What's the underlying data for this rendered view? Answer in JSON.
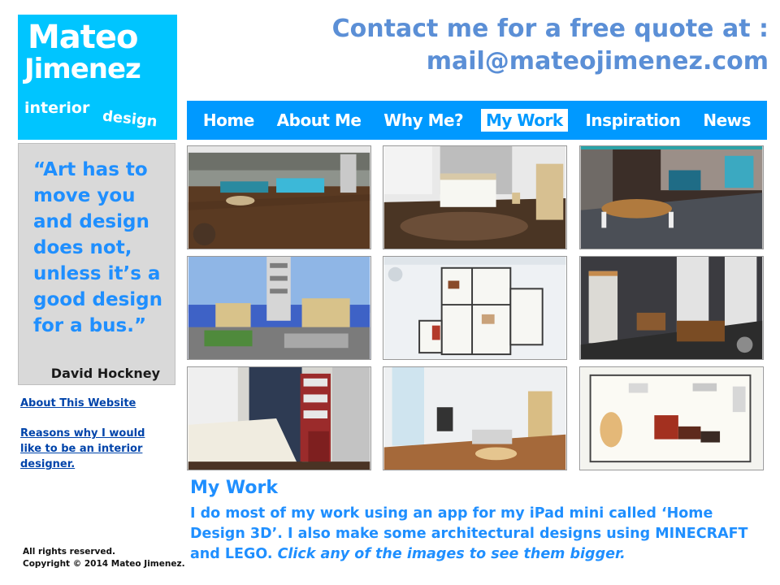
{
  "logo": {
    "line1": "Mateo",
    "line2": "Jimenez",
    "tag1": "interior",
    "tag2": "design"
  },
  "contact": {
    "line1": "Contact me for a free quote at :",
    "line2": "mail@mateojimenez.com"
  },
  "nav": {
    "items": [
      {
        "label": "Home"
      },
      {
        "label": "About Me"
      },
      {
        "label": "Why Me?"
      },
      {
        "label": "My Work",
        "active": true
      },
      {
        "label": "Inspiration"
      },
      {
        "label": "News"
      }
    ]
  },
  "quote": {
    "text": "“Art has to move you and design does not, unless it’s a good design for a bus.”",
    "author": "David Hockney"
  },
  "sidebar": {
    "links": [
      {
        "label": "About This Website"
      },
      {
        "label": "Reasons why I would like to be an interior designer."
      }
    ]
  },
  "gallery": {
    "images": [
      {
        "name": "living-room-3d"
      },
      {
        "name": "bedroom-3d"
      },
      {
        "name": "kitchen-dining-3d"
      },
      {
        "name": "minecraft-build"
      },
      {
        "name": "floor-plan-rooms"
      },
      {
        "name": "dark-bedroom-3d"
      },
      {
        "name": "bedroom-bookshelf-3d"
      },
      {
        "name": "tv-lounge-3d"
      },
      {
        "name": "floor-plan-room1-room2"
      }
    ]
  },
  "work": {
    "title": "My Work",
    "text": "I do most of my work using an app for my iPad mini called ‘Home Design 3D’. I also make some architectural  designs using MINECRAFT and LEGO. ",
    "italic": "Click any of the images to see them bigger."
  },
  "footer": {
    "line1": "All rights reserved.",
    "line2": "Copyright © 2014 Mateo Jimenez."
  },
  "colors": {
    "brand": "#00c5ff",
    "nav": "#0099ff",
    "accent_text": "#1f8fff",
    "contact": "#5b8fd6",
    "quote_bg": "#d9d9d9"
  }
}
